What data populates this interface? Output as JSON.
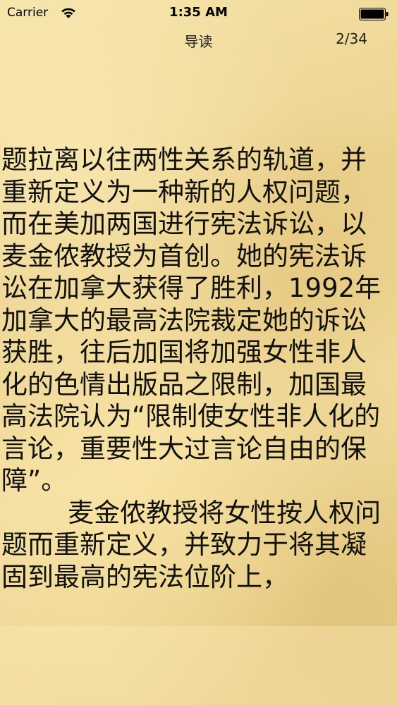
{
  "status_bar": {
    "carrier": "Carrier",
    "wifi_icon": "wifi-icon",
    "time": "1:35 AM",
    "battery_icon": "battery-icon"
  },
  "nav": {
    "title": "导读",
    "page_counter": "2/34"
  },
  "content": {
    "text": "题拉离以往两性关系的轨道，并\n重新定义为一种新的人权问题，\n而在美加两国进行宪法诉讼，以\n麦金侬教授为首创。她的宪法诉\n讼在加拿大获得了胜利，1992年\n加拿大的最高法院裁定她的诉讼\n获胜，往后加国将加强女性非人\n化的色情出版品之限制，加国最\n高法院认为“限制使女性非人化的\n言论，重要性大过言论自由的保\n障”。\n        麦金侬教授将女性按人权问\n题而重新定义，并致力于将其凝\n固到最高的宪法位阶上，"
  },
  "colors": {
    "paper": "#f2dea1",
    "text": "#111111"
  }
}
